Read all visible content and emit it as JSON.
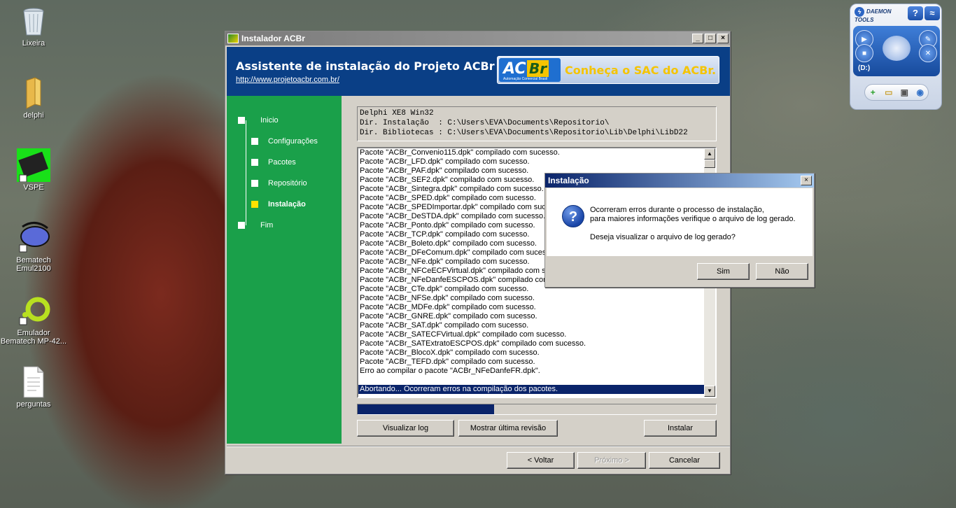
{
  "desktop": {
    "icons": [
      {
        "label": "Lixeira"
      },
      {
        "label": "delphi"
      },
      {
        "label": "VSPE"
      },
      {
        "label": "Bematech Emul2100"
      },
      {
        "label": "Emulador Bematech MP-42..."
      },
      {
        "label": "perguntas"
      }
    ]
  },
  "window": {
    "title": "Instalador ACBr",
    "minimize": "_",
    "maximize": "□",
    "close": "×",
    "header_title": "Assistente de instalação do Projeto ACBr",
    "header_link": "http://www.projetoacbr.com.br/",
    "banner": {
      "logo_ac": "AC",
      "logo_br": "Br",
      "logo_sub": "Automação Comercial Brasil",
      "text": "Conheça o SAC do ACBr."
    }
  },
  "steps": [
    {
      "label": "Inicio",
      "active": false
    },
    {
      "label": "Configurações",
      "active": false
    },
    {
      "label": "Pacotes",
      "active": false
    },
    {
      "label": "Repositório",
      "active": false
    },
    {
      "label": "Instalação",
      "active": true
    },
    {
      "label": "Fim",
      "active": false
    }
  ],
  "info": {
    "line1": "Delphi XE8 Win32",
    "line2": "Dir. Instalação  : C:\\Users\\EVA\\Documents\\Repositorio\\",
    "line3": "Dir. Bibliotecas : C:\\Users\\EVA\\Documents\\Repositorio\\Lib\\Delphi\\LibD22"
  },
  "log": [
    "Pacote \"ACBr_Convenio115.dpk\" compilado com sucesso.",
    "Pacote \"ACBr_LFD.dpk\" compilado com sucesso.",
    "Pacote \"ACBr_PAF.dpk\" compilado com sucesso.",
    "Pacote \"ACBr_SEF2.dpk\" compilado com sucesso.",
    "Pacote \"ACBr_Sintegra.dpk\" compilado com sucesso.",
    "Pacote \"ACBr_SPED.dpk\" compilado com sucesso.",
    "Pacote \"ACBr_SPEDImportar.dpk\" compilado com sucesso.",
    "Pacote \"ACBr_DeSTDA.dpk\" compilado com sucesso.",
    "Pacote \"ACBr_Ponto.dpk\" compilado com sucesso.",
    "Pacote \"ACBr_TCP.dpk\" compilado com sucesso.",
    "Pacote \"ACBr_Boleto.dpk\" compilado com sucesso.",
    "Pacote \"ACBr_DFeComum.dpk\" compilado com sucesso.",
    "Pacote \"ACBr_NFe.dpk\" compilado com sucesso.",
    "Pacote \"ACBr_NFCeECFVirtual.dpk\" compilado com sucesso.",
    "Pacote \"ACBr_NFeDanfeESCPOS.dpk\" compilado com sucesso.",
    "Pacote \"ACBr_CTe.dpk\" compilado com sucesso.",
    "Pacote \"ACBr_NFSe.dpk\" compilado com sucesso.",
    "Pacote \"ACBr_MDFe.dpk\" compilado com sucesso.",
    "Pacote \"ACBr_GNRE.dpk\" compilado com sucesso.",
    "Pacote \"ACBr_SAT.dpk\" compilado com sucesso.",
    "Pacote \"ACBr_SATECFVirtual.dpk\" compilado com sucesso.",
    "Pacote \"ACBr_SATExtratoESCPOS.dpk\" compilado com sucesso.",
    "Pacote \"ACBr_BlocoX.dpk\" compilado com sucesso.",
    "Pacote \"ACBr_TEFD.dpk\" compilado com sucesso.",
    "Erro ao compilar o pacote \"ACBr_NFeDanfeFR.dpk\".",
    "",
    "Abortando... Ocorreram erros na compilação dos pacotes."
  ],
  "log_selected_index": 26,
  "progress_fraction": 0.38,
  "buttons": {
    "view_log": "Visualizar log",
    "last_revision": "Mostrar última revisão",
    "install": "Instalar",
    "back": "< Voltar",
    "next": "Próximo >",
    "cancel": "Cancelar"
  },
  "dialog": {
    "title": "Instalação",
    "close": "×",
    "icon": "?",
    "line1": "Ocorreram erros durante o processo de instalação,",
    "line2": "para maiores informações verifique o arquivo de log gerado.",
    "line3": "Deseja visualizar o arquivo de log gerado?",
    "yes": "Sim",
    "no": "Não"
  },
  "daemon": {
    "logo": "DAEMON TOOLS",
    "help": "?",
    "rss": "≈",
    "drive_label": "(D:)"
  },
  "colors": {
    "header": "#0a3f86",
    "sidebar": "#1aa04a",
    "active_step": "#ffe300",
    "selection": "#0a246a"
  }
}
